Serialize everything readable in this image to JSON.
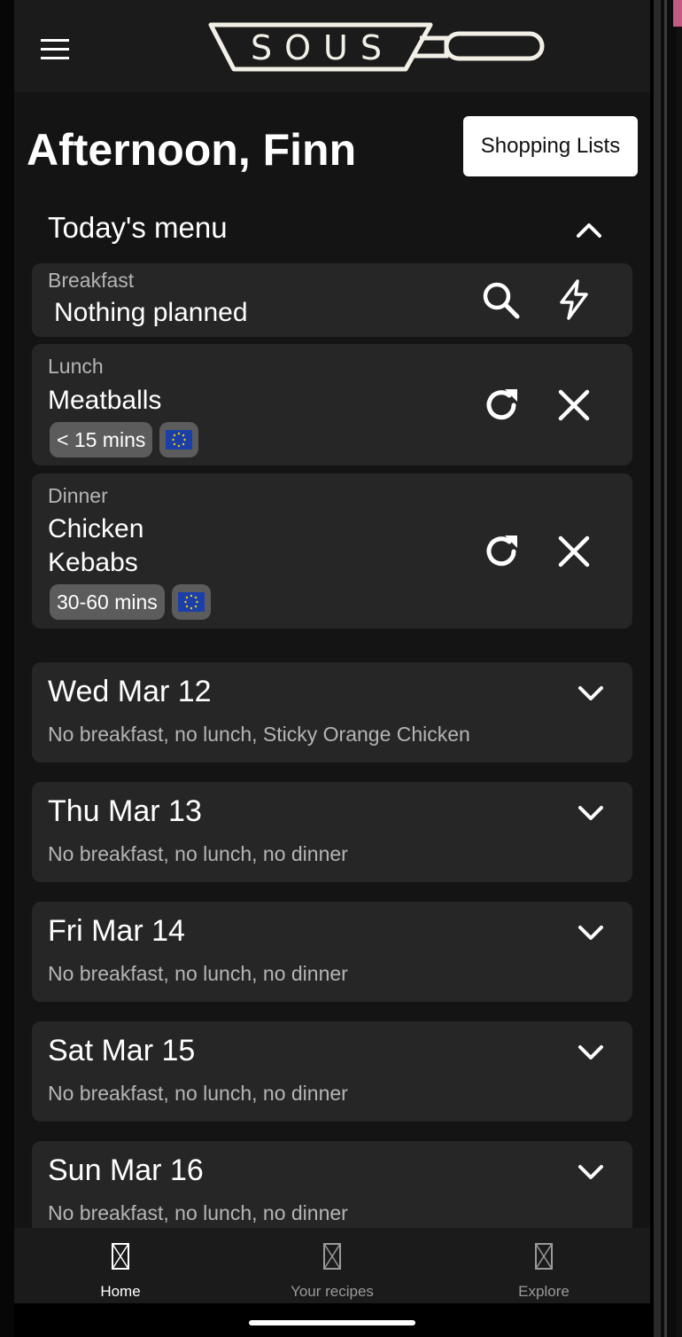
{
  "app": {
    "logo_text": "SOUS"
  },
  "header": {
    "greeting": "Afternoon, Finn",
    "shopping_lists_label": "Shopping Lists"
  },
  "todays_menu": {
    "title": "Today's menu",
    "meals": [
      {
        "label": "Breakfast",
        "name": "Nothing planned",
        "actions": [
          "search-icon",
          "lightning-icon"
        ],
        "tags": []
      },
      {
        "label": "Lunch",
        "name": "Meatballs",
        "actions": [
          "refresh-icon",
          "close-icon"
        ],
        "tags": [
          "< 15 mins"
        ],
        "flag": "EU"
      },
      {
        "label": "Dinner",
        "name_lines": [
          "Chicken",
          "Kebabs"
        ],
        "actions": [
          "refresh-icon",
          "close-icon"
        ],
        "tags": [
          "30-60 mins"
        ],
        "flag": "EU"
      }
    ]
  },
  "days": [
    {
      "title": "Wed Mar 12",
      "summary": "No breakfast, no lunch, Sticky Orange Chicken"
    },
    {
      "title": "Thu Mar 13",
      "summary": "No breakfast, no lunch, no dinner"
    },
    {
      "title": "Fri Mar 14",
      "summary": "No breakfast, no lunch, no dinner"
    },
    {
      "title": "Sat Mar 15",
      "summary": "No breakfast, no lunch, no dinner"
    },
    {
      "title": "Sun Mar 16",
      "summary": "No breakfast, no lunch, no dinner"
    }
  ],
  "bottom_nav": [
    {
      "label": "Home",
      "active": true
    },
    {
      "label": "Your recipes",
      "active": false
    },
    {
      "label": "Explore",
      "active": false
    }
  ],
  "colors": {
    "background": "#141414",
    "card": "#262626",
    "bar": "#1b1b1b",
    "muted_text": "#b5b5b5",
    "tag": "#5c5c5c",
    "inactive_nav": "#9a9a9a"
  }
}
